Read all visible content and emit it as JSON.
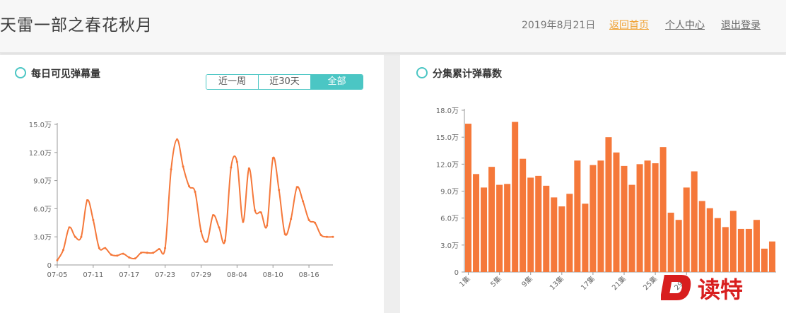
{
  "header": {
    "title": "天雷一部之春花秋月",
    "date": "2019年8月21日",
    "links": {
      "home": "返回首页",
      "profile": "个人中心",
      "logout": "退出登录"
    }
  },
  "colors": {
    "accent": "#4bc6c4",
    "series": "#f5783a",
    "link_active": "#f0a030"
  },
  "daily_panel": {
    "title": "每日可见弹幕量",
    "tabs": [
      "近一周",
      "近30天",
      "全部"
    ],
    "active_tab": 2
  },
  "episode_panel": {
    "title": "分集累计弹幕数"
  },
  "watermark": {
    "text": "读特"
  },
  "chart_data": [
    {
      "type": "line",
      "title": "每日可见弹幕量",
      "ylim": [
        0,
        15.0
      ],
      "yticks": [
        "0",
        "3.0万",
        "6.0万",
        "9.0万",
        "12.0万",
        "15.0万"
      ],
      "xticks": [
        "07-05",
        "07-11",
        "07-17",
        "07-23",
        "07-29",
        "08-04",
        "08-10",
        "08-16"
      ],
      "x": [
        "07-05",
        "07-06",
        "07-07",
        "07-08",
        "07-09",
        "07-10",
        "07-11",
        "07-12",
        "07-13",
        "07-14",
        "07-15",
        "07-16",
        "07-17",
        "07-18",
        "07-19",
        "07-20",
        "07-21",
        "07-22",
        "07-23",
        "07-24",
        "07-25",
        "07-26",
        "07-27",
        "07-28",
        "07-29",
        "07-30",
        "07-31",
        "08-01",
        "08-02",
        "08-03",
        "08-04",
        "08-05",
        "08-06",
        "08-07",
        "08-08",
        "08-09",
        "08-10",
        "08-11",
        "08-12",
        "08-13",
        "08-14",
        "08-15",
        "08-16",
        "08-17",
        "08-18",
        "08-19",
        "08-20"
      ],
      "values": [
        0.5,
        1.6,
        4.0,
        3.0,
        3.0,
        6.9,
        4.8,
        1.8,
        1.8,
        1.1,
        1.0,
        1.2,
        0.8,
        0.7,
        1.3,
        1.3,
        1.3,
        1.7,
        1.8,
        10.2,
        13.4,
        10.5,
        8.4,
        7.8,
        3.6,
        2.5,
        5.3,
        4.0,
        2.6,
        10.4,
        11.0,
        4.6,
        10.3,
        5.8,
        5.6,
        4.2,
        11.4,
        8.0,
        3.3,
        4.9,
        8.3,
        6.8,
        4.8,
        4.5,
        3.2,
        3.0,
        3.0
      ]
    },
    {
      "type": "bar",
      "title": "分集累计弹幕数",
      "ylim": [
        0,
        18.0
      ],
      "yticks": [
        "0",
        "3.0万",
        "6.0万",
        "9.0万",
        "12.0万",
        "15.0万",
        "18.0万"
      ],
      "xticks": [
        "1集",
        "5集",
        "9集",
        "13集",
        "17集",
        "21集",
        "25集",
        "29集"
      ],
      "categories": [
        "1集",
        "2集",
        "3集",
        "4集",
        "5集",
        "6集",
        "7集",
        "8集",
        "9集",
        "10集",
        "11集",
        "12集",
        "13集",
        "14集",
        "15集",
        "16集",
        "17集",
        "18集",
        "19集",
        "20集",
        "21集",
        "22集",
        "23集",
        "24集",
        "25集",
        "26集",
        "27集",
        "28集",
        "29集",
        "30集",
        "31集",
        "32集",
        "33集",
        "34集",
        "35集",
        "36集",
        "37集",
        "38集",
        "39集",
        "40集"
      ],
      "values": [
        16.5,
        10.9,
        9.4,
        11.7,
        9.7,
        9.8,
        16.7,
        12.6,
        10.5,
        10.7,
        9.6,
        8.3,
        7.3,
        8.7,
        12.4,
        7.6,
        11.9,
        12.4,
        15.0,
        13.3,
        11.8,
        9.7,
        12.0,
        12.4,
        12.1,
        13.9,
        6.6,
        5.8,
        9.4,
        11.2,
        7.9,
        7.1,
        6.0,
        5.0,
        6.8,
        4.8,
        4.8,
        5.8,
        2.6,
        3.4
      ]
    }
  ]
}
